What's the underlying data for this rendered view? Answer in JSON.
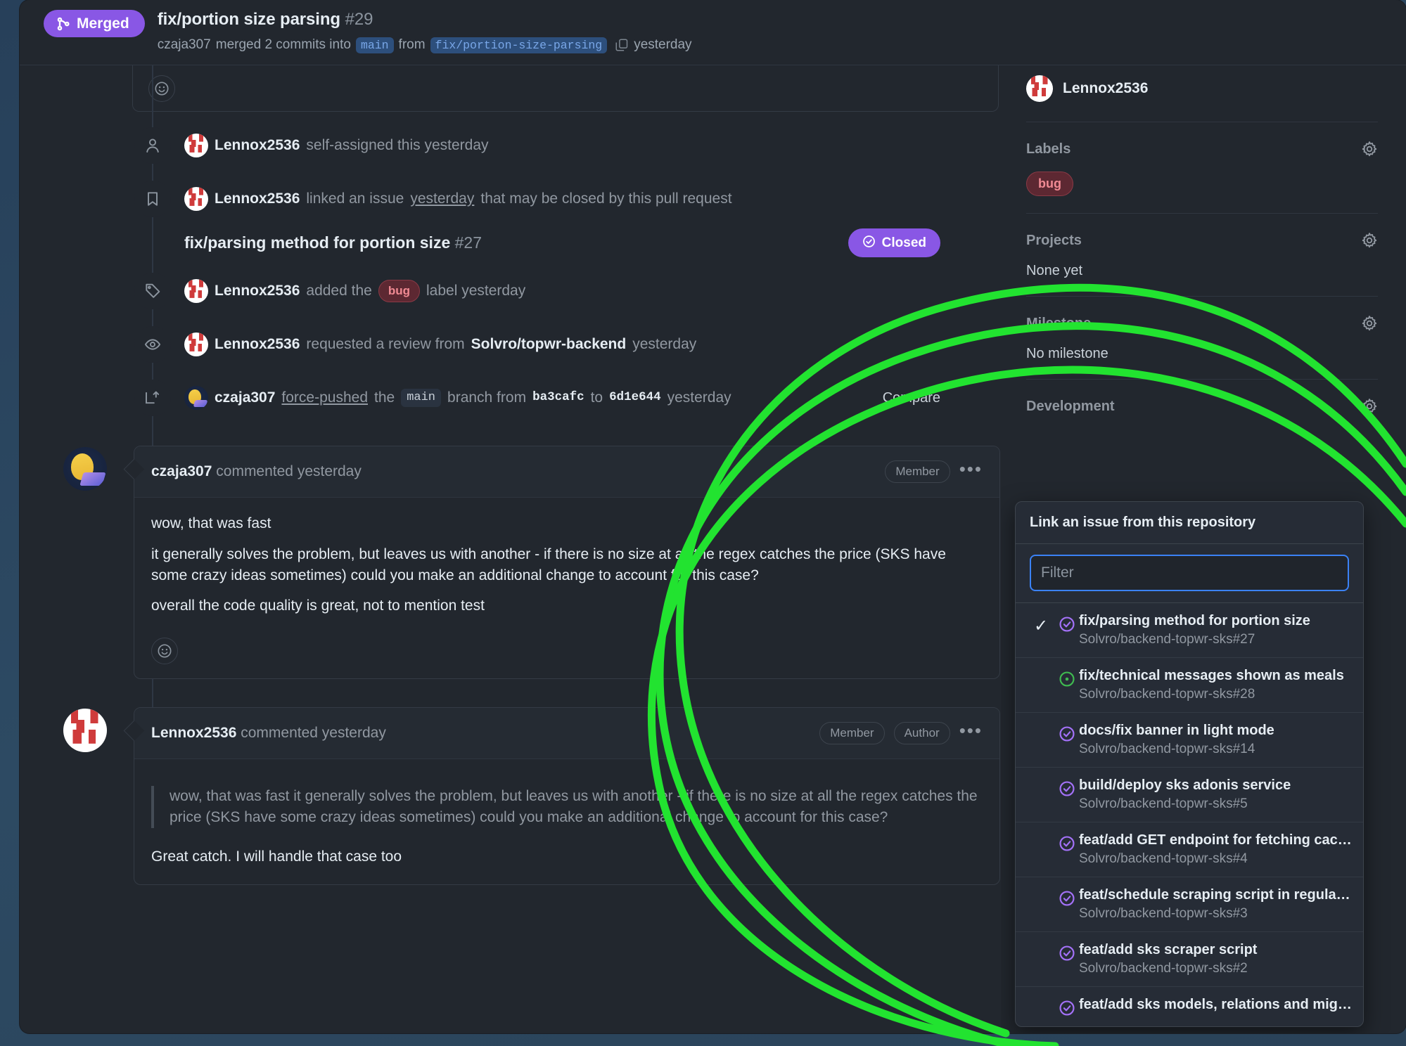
{
  "header": {
    "state_badge": "Merged",
    "title": "fix/portion size parsing",
    "number": "#29",
    "merge_actor": "czaja307",
    "merge_text_1": "merged 2 commits into",
    "base_branch": "main",
    "from_word": "from",
    "head_branch": "fix/portion-size-parsing",
    "time": "yesterday",
    "copy_icon": "copy-icon"
  },
  "timeline": [
    {
      "icon": "person-icon",
      "avatar": "lennox-avatar",
      "actor": "Lennox2536",
      "text": "self-assigned this yesterday"
    },
    {
      "icon": "bookmark-icon",
      "avatar": "lennox-avatar",
      "actor": "Lennox2536",
      "text_a": "linked an issue",
      "link": "yesterday",
      "text_b": "that may be closed by this pull request"
    },
    {
      "icon": "tag-icon",
      "avatar": "lennox-avatar",
      "actor": "Lennox2536",
      "text_a": "added the",
      "label": "bug",
      "text_b": "label yesterday"
    },
    {
      "icon": "eye-icon",
      "avatar": "lennox-avatar",
      "actor": "Lennox2536",
      "text_a": "requested a review from",
      "strong": "Solvro/topwr-backend",
      "text_b": "yesterday"
    },
    {
      "icon": "force-push-icon",
      "avatar": "duck-avatar",
      "actor": "czaja307",
      "text_a": "force-pushed",
      "text_the": "the",
      "branch": "main",
      "text_b": "branch from",
      "sha_from": "ba3cafc",
      "text_to": "to",
      "sha_to": "6d1e644",
      "text_c": "yesterday",
      "compare_label": "Compare"
    }
  ],
  "linked_issue": {
    "title": "fix/parsing method for portion size",
    "number": "#27",
    "status_badge": "Closed",
    "status_icon": "check-circle-icon"
  },
  "comments": [
    {
      "avatar": "duck-avatar",
      "author": "czaja307",
      "meta": "commented yesterday",
      "roles": [
        "Member"
      ],
      "menu_icon": "kebab-menu-icon",
      "paragraphs": [
        "wow, that was fast",
        "it generally solves the problem, but leaves us with another - if there is no size at all the regex catches the price (SKS have some crazy ideas sometimes) could you make an additional change to account for this case?",
        "overall the code quality is great, not to mention test"
      ],
      "reaction_icon": "smiley-face-icon"
    },
    {
      "avatar": "lennox-avatar",
      "author": "Lennox2536",
      "meta": "commented yesterday",
      "roles": [
        "Member",
        "Author"
      ],
      "menu_icon": "kebab-menu-icon",
      "quote": "wow, that was fast it generally solves the problem, but leaves us with another - if there is no size at all the regex catches the price (SKS have some crazy ideas sometimes) could you make an additional change to account for this case?",
      "paragraphs": [
        "Great catch. I will handle that case too"
      ]
    }
  ],
  "sidebar": {
    "assignee": {
      "avatar": "lennox-avatar",
      "name": "Lennox2536"
    },
    "labels": {
      "title": "Labels",
      "gear_icon": "gear-icon",
      "items": [
        "bug"
      ]
    },
    "projects": {
      "title": "Projects",
      "gear_icon": "gear-icon",
      "empty": "None yet"
    },
    "milestone": {
      "title": "Milestone",
      "gear_icon": "gear-icon",
      "empty": "No milestone"
    },
    "development": {
      "title": "Development",
      "gear_icon": "gear-icon"
    }
  },
  "dropdown": {
    "title": "Link an issue from this repository",
    "filter_placeholder": "Filter",
    "filter_value": "",
    "items": [
      {
        "title": "fix/parsing method for portion size",
        "sub": "Solvro/backend-topwr-sks#27",
        "state": "closed",
        "selected": true
      },
      {
        "title": "fix/technical messages shown as meals",
        "sub": "Solvro/backend-topwr-sks#28",
        "state": "open",
        "selected": false
      },
      {
        "title": "docs/fix banner in light mode",
        "sub": "Solvro/backend-topwr-sks#14",
        "state": "closed",
        "selected": false
      },
      {
        "title": "build/deploy sks adonis service",
        "sub": "Solvro/backend-topwr-sks#5",
        "state": "closed",
        "selected": false
      },
      {
        "title": "feat/add GET endpoint for fetching cac…",
        "sub": "Solvro/backend-topwr-sks#4",
        "state": "closed",
        "selected": false
      },
      {
        "title": "feat/schedule scraping script in regula…",
        "sub": "Solvro/backend-topwr-sks#3",
        "state": "closed",
        "selected": false
      },
      {
        "title": "feat/add sks scraper script",
        "sub": "Solvro/backend-topwr-sks#2",
        "state": "closed",
        "selected": false
      },
      {
        "title": "feat/add sks models, relations and mig…",
        "sub": "",
        "state": "closed",
        "selected": false
      }
    ]
  },
  "colors": {
    "merged_purple": "#8957e5",
    "closed_purple": "#a371f7",
    "open_green": "#3fb950",
    "label_bug": "#f08a93",
    "focus_blue": "#3b82f6",
    "annotation_green": "#22e330"
  }
}
